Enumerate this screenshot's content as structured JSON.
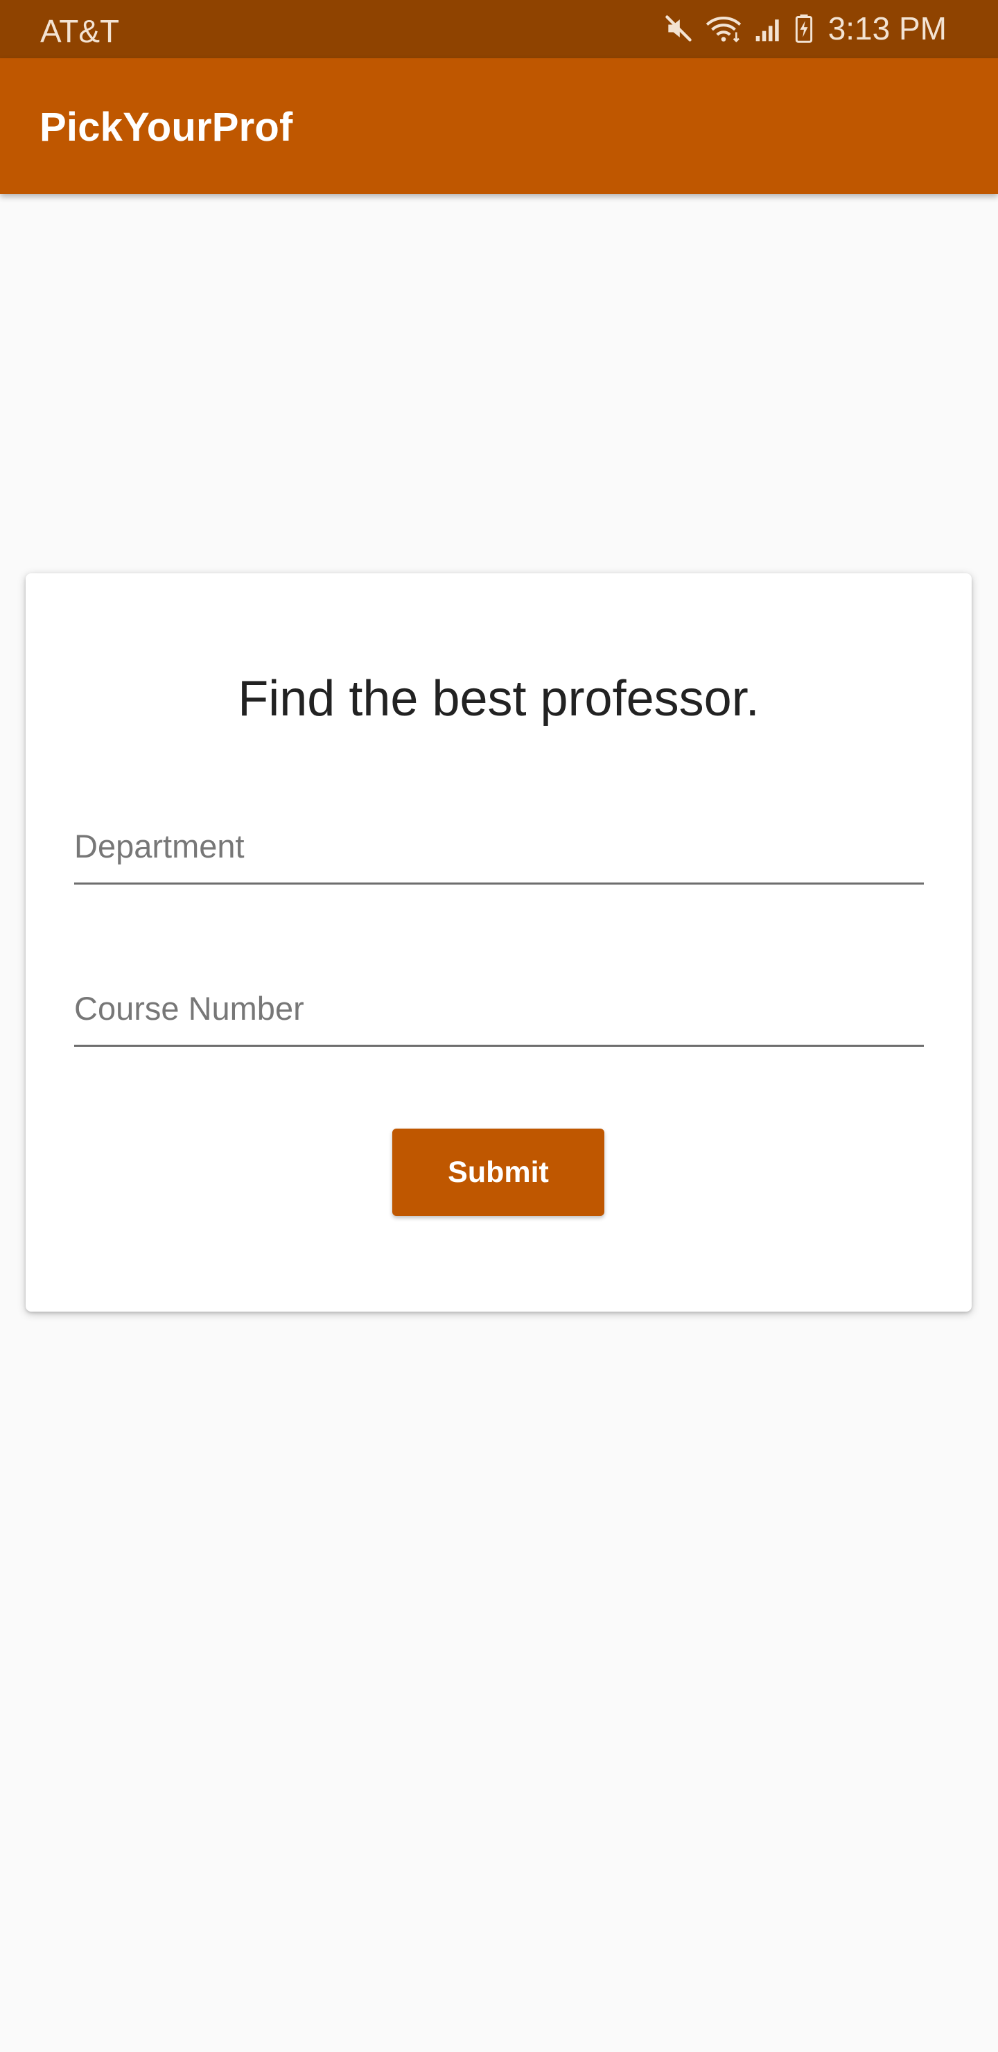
{
  "status_bar": {
    "carrier": "AT&T",
    "time": "3:13 PM",
    "icons": [
      "mute-icon",
      "wifi-icon",
      "signal-icon",
      "battery-charging-icon"
    ],
    "background_color": "#8f4300"
  },
  "app_bar": {
    "title": "PickYourProf",
    "background_color": "#bf5700"
  },
  "card": {
    "heading": "Find the best professor.",
    "department_field": {
      "placeholder": "Department",
      "value": ""
    },
    "course_number_field": {
      "placeholder": "Course Number",
      "value": ""
    },
    "submit_label": "Submit",
    "accent_color": "#bf5700"
  }
}
